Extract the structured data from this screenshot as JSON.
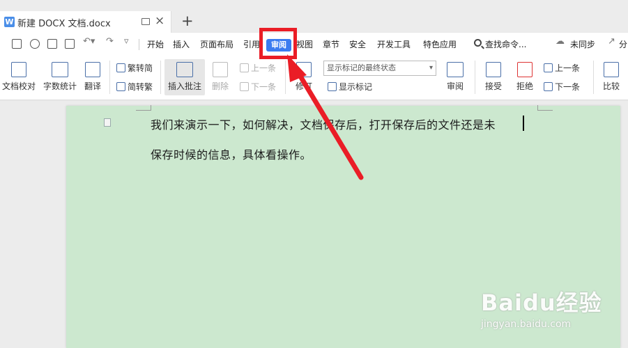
{
  "tab": {
    "logo": "W",
    "title": "新建 DOCX 文档.docx",
    "close": "×",
    "new_tab": "+"
  },
  "menu": {
    "items": [
      "开始",
      "插入",
      "页面布局",
      "引用",
      "视图",
      "章节",
      "安全",
      "开发工具",
      "特色应用"
    ],
    "active": "审阅",
    "search": "查找命令...",
    "sync": "未同步",
    "share": "分"
  },
  "toolbar": {
    "proof": "文档校对",
    "wordcount": "字数统计",
    "translate": "翻译",
    "trad_to_simp": "繁转简",
    "simp_to_trad": "简转繁",
    "insert_comment": "插入批注",
    "delete": "删除",
    "prev_comment": "上一条",
    "next_comment": "下一条",
    "revise": "修订",
    "markup_state": "显示标记的最终状态",
    "show_markup": "显示标记",
    "review": "审阅",
    "accept": "接受",
    "reject": "拒绝",
    "prev_change": "上一条",
    "next_change": "下一条",
    "compare": "比较"
  },
  "document": {
    "line1": "我们来演示一下，如何解决，文档保存后，打开保存后的文件还是未",
    "line2": "保存时候的信息，具体看操作。"
  },
  "watermark": {
    "main": "Baidu经验",
    "sub": "jingyan.baidu.com"
  },
  "colors": {
    "accent": "#3b7cf0",
    "annotation_red": "#ea1d26",
    "page_bg": "#cce8cf"
  }
}
